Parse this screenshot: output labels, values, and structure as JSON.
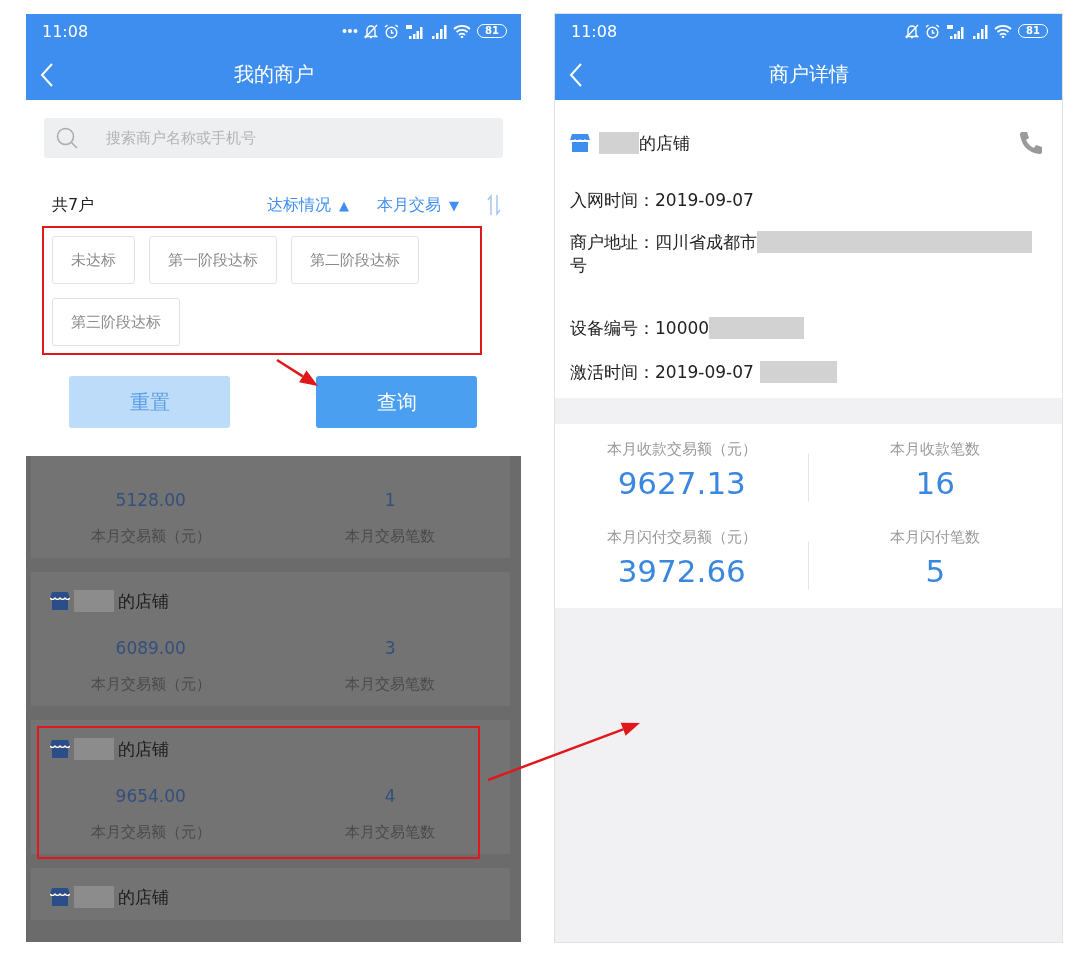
{
  "left_screen": {
    "status_bar": {
      "time": "11:08",
      "more_notifications": true,
      "battery": "81"
    },
    "header": {
      "title": "我的商户"
    },
    "search": {
      "placeholder": "搜索商户名称或手机号"
    },
    "filter_bar": {
      "count": "共7户",
      "sorts": [
        {
          "label": "达标情况",
          "arrow": "▲"
        },
        {
          "label": "本月交易",
          "arrow": "▼"
        }
      ]
    },
    "filter_chips": [
      {
        "label": "未达标"
      },
      {
        "label": "第一阶段达标"
      },
      {
        "label": "第二阶段达标"
      },
      {
        "label": "第三阶段达标"
      }
    ],
    "buttons": [
      {
        "label": "重置",
        "kind": "secondary"
      },
      {
        "label": "查询",
        "kind": "primary"
      }
    ],
    "shop_list": {
      "dimmed": true,
      "shops": [
        {
          "amount": "5128.00",
          "amount_label": "本月交易额（元）",
          "count": "1",
          "count_label": "本月交易笔数"
        },
        {
          "name": "的店铺",
          "redacted": true,
          "amount": "6089.00",
          "amount_label": "本月交易额（元）",
          "count": "3",
          "count_label": "本月交易笔数"
        },
        {
          "name": "的店铺",
          "redacted": true,
          "amount": "9654.00",
          "amount_label": "本月交易额（元）",
          "count": "4",
          "count_label": "本月交易笔数"
        },
        {
          "name": "的店铺",
          "redacted": true
        }
      ]
    }
  },
  "right_screen": {
    "status_bar": {
      "time": "11:08",
      "more_notifications": false,
      "battery": "81"
    },
    "header": {
      "title": "商户详情"
    },
    "shop": {
      "name": "的店铺",
      "redacted": true
    },
    "info": [
      {
        "text": "入网时间：2019-09-07",
        "redacted": false
      },
      {
        "text": "商户地址：四川省成都市",
        "redacted": true,
        "continuation": "号"
      },
      {
        "text": "设备编号：10000",
        "redacted": true
      },
      {
        "text": "激活时间：2019-09-07",
        "redacted": true
      }
    ],
    "stats": [
      {
        "label": "本月收款交易额（元）",
        "value": "9627.13"
      },
      {
        "label": "本月收款笔数",
        "value": "16"
      },
      {
        "label": "本月闪付交易额（元）",
        "value": "3972.66"
      },
      {
        "label": "本月闪付笔数",
        "value": "5"
      }
    ]
  },
  "annotations": [
    {
      "kind": "frame"
    },
    {
      "kind": "arrow"
    },
    {
      "kind": "frame"
    },
    {
      "kind": "arrow"
    }
  ]
}
